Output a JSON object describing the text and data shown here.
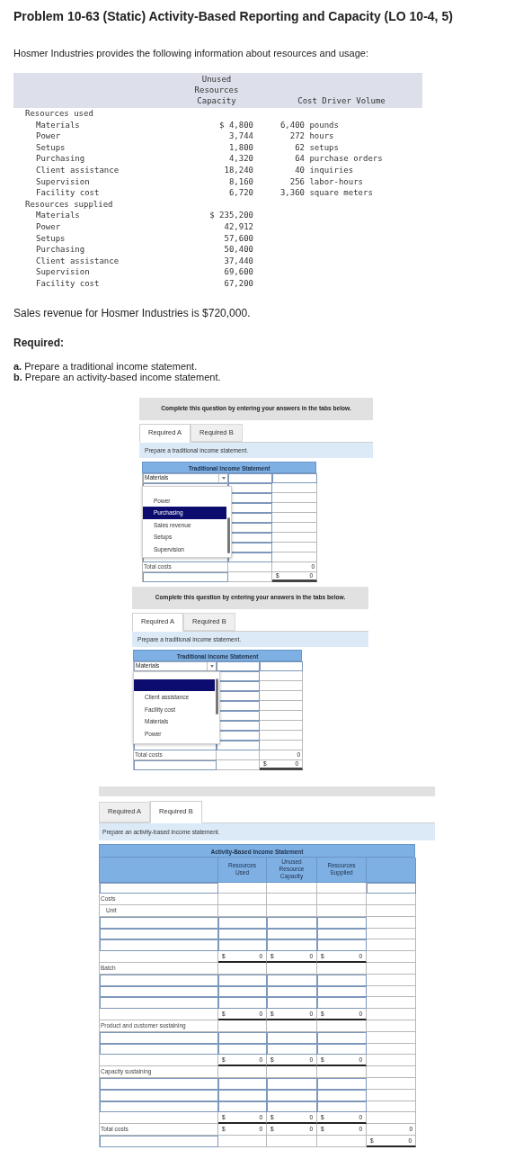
{
  "title": "Problem 10-63 (Static) Activity-Based Reporting and Capacity (LO 10-4, 5)",
  "intro": "Hosmer Industries provides the following information about resources and usage:",
  "data_table": {
    "columns": [
      "Unused Resources Capacity",
      "Cost Driver Volume"
    ],
    "rows": [
      {
        "kind": "group",
        "label": "Resources used"
      },
      {
        "kind": "item",
        "label": "Materials",
        "capacity": "$ 4,800",
        "driver": "6,400 pounds"
      },
      {
        "kind": "item",
        "label": "Power",
        "capacity": "3,744",
        "driver": "272 hours"
      },
      {
        "kind": "item",
        "label": "Setups",
        "capacity": "1,800",
        "driver": "62 setups"
      },
      {
        "kind": "item",
        "label": "Purchasing",
        "capacity": "4,320",
        "driver": "64 purchase orders"
      },
      {
        "kind": "item",
        "label": "Client assistance",
        "capacity": "18,240",
        "driver": "40 inquiries"
      },
      {
        "kind": "item",
        "label": "Supervision",
        "capacity": "8,160",
        "driver": "256 labor-hours"
      },
      {
        "kind": "item",
        "label": "Facility cost",
        "capacity": "6,720",
        "driver": "3,360 square meters"
      },
      {
        "kind": "group",
        "label": "Resources supplied"
      },
      {
        "kind": "item",
        "label": "Materials",
        "capacity": "$ 235,200"
      },
      {
        "kind": "item",
        "label": "Power",
        "capacity": "42,912"
      },
      {
        "kind": "item",
        "label": "Setups",
        "capacity": "57,600"
      },
      {
        "kind": "item",
        "label": "Purchasing",
        "capacity": "50,400"
      },
      {
        "kind": "item",
        "label": "Client assistance",
        "capacity": "37,440"
      },
      {
        "kind": "item",
        "label": "Supervision",
        "capacity": "69,600"
      },
      {
        "kind": "item",
        "label": "Facility cost",
        "capacity": "67,200"
      }
    ]
  },
  "sales_note": "Sales revenue for Hosmer Industries is $720,000.",
  "required_heading": "Required:",
  "required_items": [
    "**a.** Prepare a traditional income statement.",
    "**b.** Prepare an activity-based income statement."
  ],
  "panels": [
    {
      "kind": "traditional",
      "banner": "Complete this question by entering your answers in the tabs below.",
      "tabs": [
        {
          "label": "Required A",
          "selected": true
        },
        {
          "label": "Required B",
          "selected": false
        }
      ],
      "prompt": "Prepare a traditional income statement.",
      "statement": {
        "title": "Traditional Income Statement",
        "rows": [
          {
            "kind": "select",
            "value": "Materials"
          },
          {
            "kind": "entry"
          },
          {
            "kind": "entry"
          },
          {
            "kind": "entry"
          },
          {
            "kind": "entry"
          },
          {
            "kind": "entry"
          },
          {
            "kind": "entry"
          },
          {
            "kind": "entry"
          },
          {
            "kind": "entry"
          },
          {
            "kind": "total",
            "label": "Total costs",
            "value": "0"
          },
          {
            "kind": "result",
            "currency": "$",
            "value": "0"
          }
        ]
      },
      "dropdown": {
        "options": [
          {
            "label": "Power",
            "selected": false
          },
          {
            "label": "Purchasing",
            "selected": true
          },
          {
            "label": "Sales revenue",
            "selected": false
          },
          {
            "label": "Setups",
            "selected": false
          },
          {
            "label": "Supervision",
            "selected": false
          }
        ]
      }
    },
    {
      "kind": "traditional",
      "banner": "Complete this question by entering your answers in the tabs below.",
      "tabs": [
        {
          "label": "Required A",
          "selected": true
        },
        {
          "label": "Required B",
          "selected": false
        }
      ],
      "prompt": "Prepare a traditional income statement.",
      "statement": {
        "title": "Traditional Income Statement",
        "rows": [
          {
            "kind": "select",
            "value": "Materials"
          },
          {
            "kind": "entry"
          },
          {
            "kind": "entry"
          },
          {
            "kind": "entry"
          },
          {
            "kind": "entry"
          },
          {
            "kind": "entry"
          },
          {
            "kind": "entry"
          },
          {
            "kind": "entry"
          },
          {
            "kind": "entry"
          },
          {
            "kind": "total",
            "label": "Total costs",
            "value": "0"
          },
          {
            "kind": "result",
            "currency": "$",
            "value": "0"
          }
        ]
      },
      "dropdown": {
        "options": [
          {
            "selected": true
          },
          {
            "label": "Client assistance",
            "selected": false
          },
          {
            "label": "Facility cost",
            "selected": false
          },
          {
            "label": "Materials",
            "selected": false
          },
          {
            "label": "Power",
            "selected": false
          }
        ]
      }
    },
    {
      "kind": "activity",
      "tabs": [
        {
          "label": "Required A",
          "selected": false
        },
        {
          "label": "Required B",
          "selected": true
        }
      ],
      "prompt": "Prepare an activity-based income statement.",
      "statement": {
        "title": "Activity-Based Income Statement",
        "columns": [
          "Resources Used",
          "Unused Resource Capacity",
          "Resources Supplied"
        ],
        "rows": [
          {
            "kind": "input"
          },
          {
            "kind": "section",
            "label": "Costs"
          },
          {
            "kind": "subsection",
            "label": "Unit"
          },
          {
            "kind": "entry"
          },
          {
            "kind": "entry"
          },
          {
            "kind": "entry"
          },
          {
            "kind": "subtotal",
            "cells": [
              {
                "currency": "$",
                "value": "0"
              },
              {
                "currency": "$",
                "value": "0"
              },
              {
                "currency": "$",
                "value": "0"
              }
            ]
          },
          {
            "kind": "section",
            "label": "Batch"
          },
          {
            "kind": "entry"
          },
          {
            "kind": "entry"
          },
          {
            "kind": "entry"
          },
          {
            "kind": "subtotal",
            "cells": [
              {
                "currency": "$",
                "value": "0"
              },
              {
                "currency": "$",
                "value": "0"
              },
              {
                "currency": "$",
                "value": "0"
              }
            ]
          },
          {
            "kind": "section",
            "label": "Product and customer sustaining"
          },
          {
            "kind": "entry"
          },
          {
            "kind": "entry"
          },
          {
            "kind": "subtotal",
            "cells": [
              {
                "currency": "$",
                "value": "0"
              },
              {
                "currency": "$",
                "value": "0"
              },
              {
                "currency": "$",
                "value": "0"
              }
            ]
          },
          {
            "kind": "section",
            "label": "Capacity sustaining"
          },
          {
            "kind": "entry"
          },
          {
            "kind": "entry"
          },
          {
            "kind": "entry"
          },
          {
            "kind": "subtotal",
            "cells": [
              {
                "currency": "$",
                "value": "0"
              },
              {
                "currency": "$",
                "value": "0"
              },
              {
                "currency": "$",
                "value": "0"
              }
            ]
          },
          {
            "kind": "total",
            "label": "Total costs",
            "cells": [
              {
                "currency": "$",
                "value": "0"
              },
              {
                "currency": "$",
                "value": "0"
              },
              {
                "currency": "$",
                "value": "0"
              }
            ],
            "value": "0"
          },
          {
            "kind": "result",
            "currency": "$",
            "value": "0"
          }
        ]
      }
    }
  ]
}
